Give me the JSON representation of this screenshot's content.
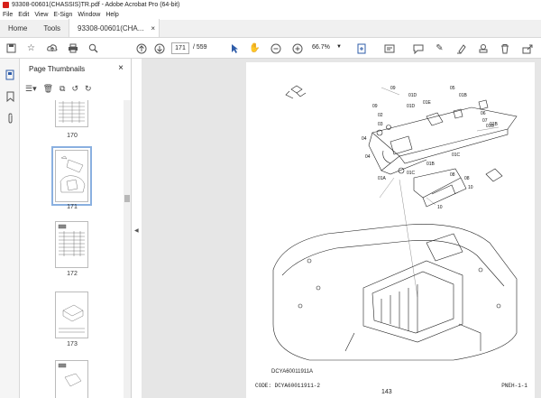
{
  "window": {
    "title": "93308-00601(CHASSIS)TR.pdf - Adobe Acrobat Pro (64-bit)"
  },
  "menu": [
    "File",
    "Edit",
    "View",
    "E-Sign",
    "Window",
    "Help"
  ],
  "tabs": {
    "home": "Home",
    "tools": "Tools",
    "doc": "93308-00601(CHA...",
    "close": "×"
  },
  "toolbar": {
    "page_current": "171",
    "page_total": "/  559",
    "zoom": "66.7%"
  },
  "panel": {
    "title": "Page Thumbnails",
    "close": "×",
    "thumbs": [
      {
        "num": "170"
      },
      {
        "num": "171"
      },
      {
        "num": "172"
      },
      {
        "num": "173"
      }
    ]
  },
  "page": {
    "figure_id": "DCYA60011911A",
    "code_left": "CODE: DCYA60011911-2",
    "page_number": "143",
    "code_right": "PNEH-1-1",
    "part_labels": [
      "09",
      "01D",
      "05",
      "01B",
      "01E",
      "02",
      "03",
      "01D",
      "09",
      "04",
      "06",
      "07",
      "01B",
      "08",
      "01C",
      "04",
      "01B",
      "01C",
      "01A",
      "10",
      "08",
      "10",
      "01B"
    ]
  },
  "icons": {
    "save": "save-icon",
    "bookmark": "bookmark-icon",
    "upload": "upload-icon",
    "print": "print-icon",
    "search": "search-icon",
    "up": "arrow-up-icon",
    "down": "arrow-down-icon",
    "select": "select-cursor-icon",
    "hand": "hand-icon",
    "zoom_out": "zoom-out-icon",
    "zoom_in": "zoom-in-icon"
  }
}
